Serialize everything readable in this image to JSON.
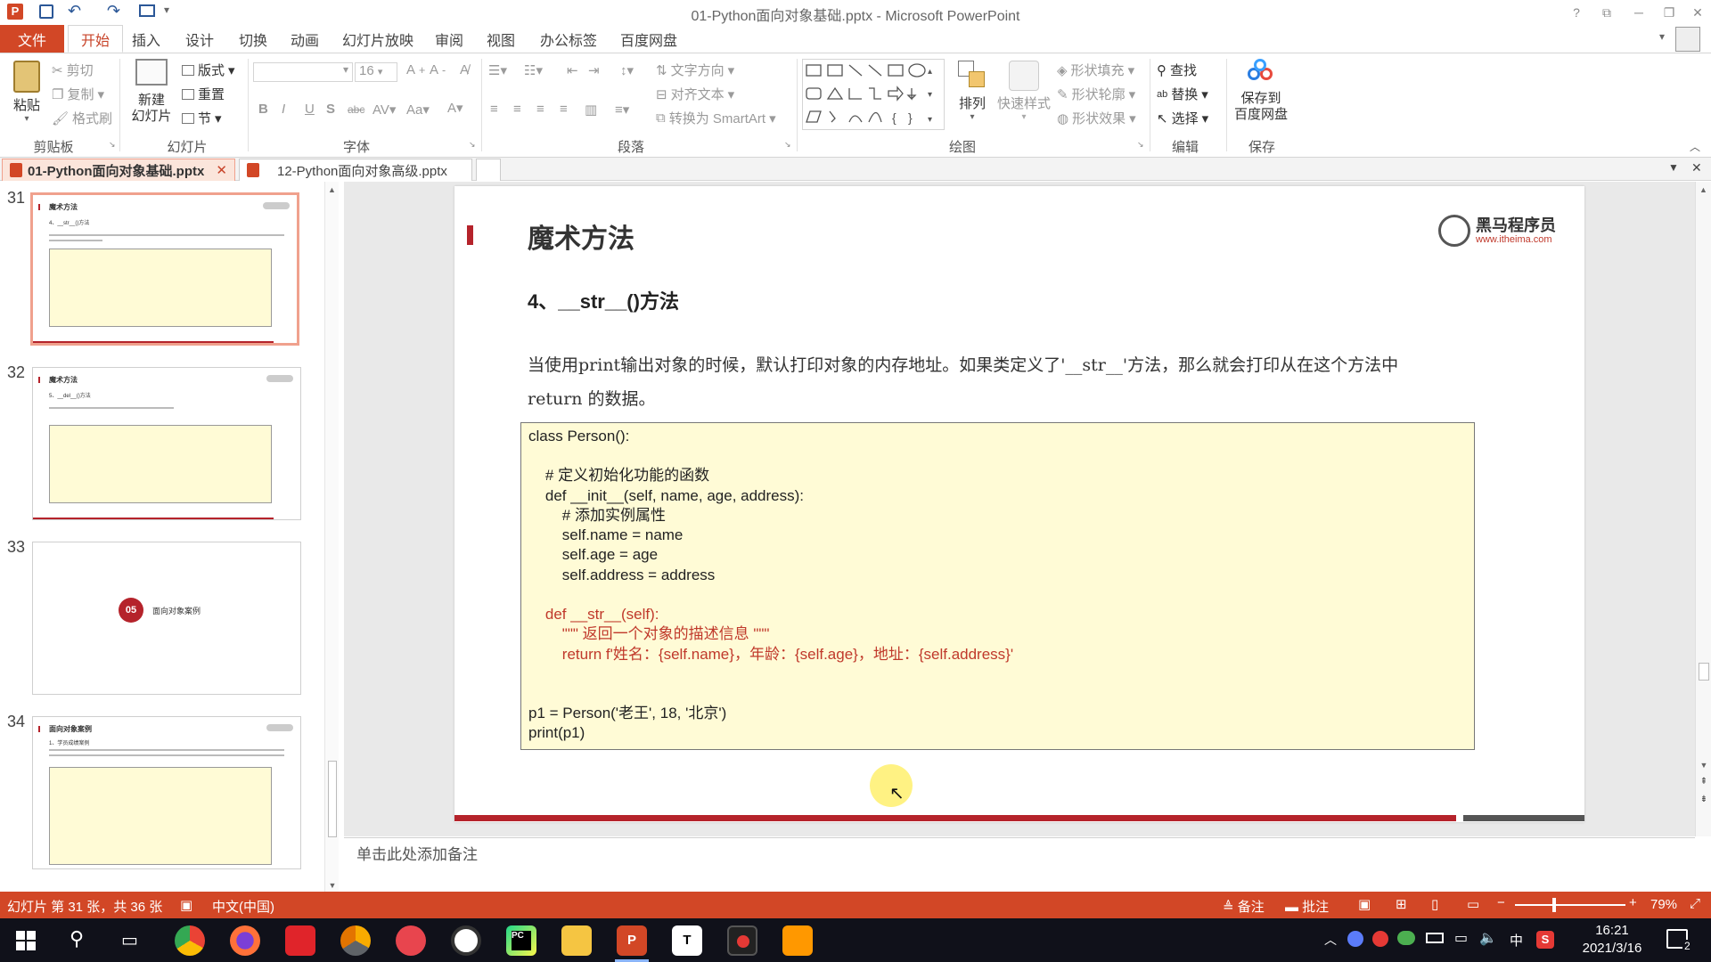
{
  "app": {
    "title": "01-Python面向对象基础.pptx - Microsoft PowerPoint"
  },
  "menu": {
    "tabs": [
      "文件",
      "开始",
      "插入",
      "设计",
      "切换",
      "动画",
      "幻灯片放映",
      "审阅",
      "视图",
      "办公标签",
      "百度网盘"
    ]
  },
  "ribbon": {
    "clipboard": {
      "paste": "粘贴",
      "cut": "剪切",
      "copy": "复制",
      "format_painter": "格式刷",
      "label": "剪贴板"
    },
    "slides": {
      "new_slide": "新建\n幻灯片",
      "layout": "版式",
      "reset": "重置",
      "section": "节",
      "label": "幻灯片"
    },
    "font": {
      "size": "16",
      "label": "字体"
    },
    "paragraph": {
      "text_direction": "文字方向",
      "align_text": "对齐文本",
      "smartart": "转换为 SmartArt",
      "label": "段落"
    },
    "drawing": {
      "arrange": "排列",
      "quick_styles": "快速样式",
      "shape_fill": "形状填充",
      "shape_outline": "形状轮廓",
      "shape_effects": "形状效果",
      "label": "绘图"
    },
    "editing": {
      "find": "查找",
      "replace": "替换",
      "select": "选择",
      "label": "编辑"
    },
    "save": {
      "save_to": "保存到\n百度网盘",
      "label": "保存"
    }
  },
  "doc_tabs": [
    {
      "name": "01-Python面向对象基础.pptx",
      "active": true
    },
    {
      "name": "12-Python面向对象高级.pptx",
      "active": false
    }
  ],
  "thumbnails": [
    {
      "num": "31",
      "title": "魔术方法",
      "sub": "4、__str__()方法",
      "selected": true
    },
    {
      "num": "32",
      "title": "魔术方法",
      "sub": "5、__del__()方法",
      "selected": false
    },
    {
      "num": "33",
      "badge": "05",
      "text": "面向对象案例",
      "selected": false
    },
    {
      "num": "34",
      "title": "面向对象案例",
      "sub": "1、学员成绩案例",
      "selected": false
    }
  ],
  "slide": {
    "title": "魔术方法",
    "logo_name": "黑马程序员",
    "logo_url": "www.itheima.com",
    "subtitle": "4、__str__()方法",
    "body_line1": "当使用print输出对象的时候，默认打印对象的内存地址。如果类定义了'__str__'方法，那么就会打印从在这个方法中",
    "body_line2": "return 的数据。",
    "code": [
      "class Person():",
      "",
      "    # 定义初始化功能的函数",
      "    def __init__(self, name, age, address):",
      "        # 添加实例属性",
      "        self.name = name",
      "        self.age = age",
      "        self.address = address",
      "",
      "    def __str__(self):",
      "        \"\"\" 返回一个对象的描述信息 \"\"\"",
      "        return f'姓名：{self.name}，年龄：{self.age}，地址：{self.address}'",
      "",
      "",
      "p1 = Person('老王', 18, '北京')",
      "print(p1)"
    ]
  },
  "notes_placeholder": "单击此处添加备注",
  "status": {
    "slide_info": "幻灯片 第 31 张，共 36 张",
    "language": "中文(中国)",
    "notes": "备注",
    "comments": "批注",
    "zoom": "79%"
  },
  "taskbar": {
    "time": "16:21",
    "date": "2021/3/16",
    "ime": "中",
    "notif_count": "2"
  },
  "colors": {
    "accent": "#d24726",
    "slide_red": "#b5232b",
    "code_bg": "#fffbd6",
    "code_red": "#c0392b"
  }
}
